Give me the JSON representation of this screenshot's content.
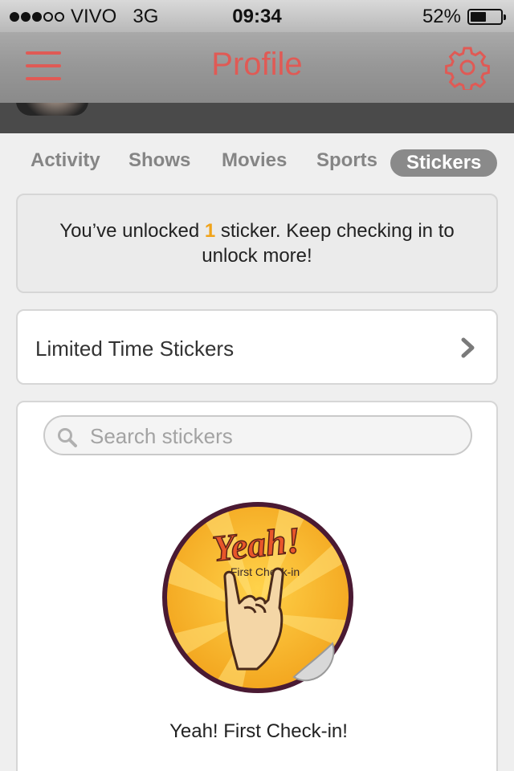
{
  "status_bar": {
    "carrier": "VIVO",
    "network": "3G",
    "time": "09:34",
    "battery_label": "52%",
    "battery_level": 0.52,
    "signal_bars_on": 3,
    "signal_bars_total": 5
  },
  "nav": {
    "title": "Profile",
    "menu_icon": "hamburger-menu-icon",
    "settings_icon": "gear-icon",
    "accent_color": "#e05a55"
  },
  "tabs": [
    {
      "label": "Activity",
      "active": false
    },
    {
      "label": "Shows",
      "active": false
    },
    {
      "label": "Movies",
      "active": false
    },
    {
      "label": "Sports",
      "active": false
    },
    {
      "label": "Stickers",
      "active": true
    }
  ],
  "info": {
    "prefix": "You’ve unlocked ",
    "count": "1",
    "suffix": " sticker. Keep checking in to unlock more!",
    "count_color": "#f0a319"
  },
  "limited": {
    "label": "Limited Time Stickers",
    "icon": "chevron-right-icon"
  },
  "search": {
    "placeholder": "Search stickers",
    "value": "",
    "icon": "search-icon"
  },
  "sticker": {
    "badge_title": "Yeah!",
    "badge_subtitle": "First Check-in",
    "caption": "Yeah! First Check-in!"
  }
}
